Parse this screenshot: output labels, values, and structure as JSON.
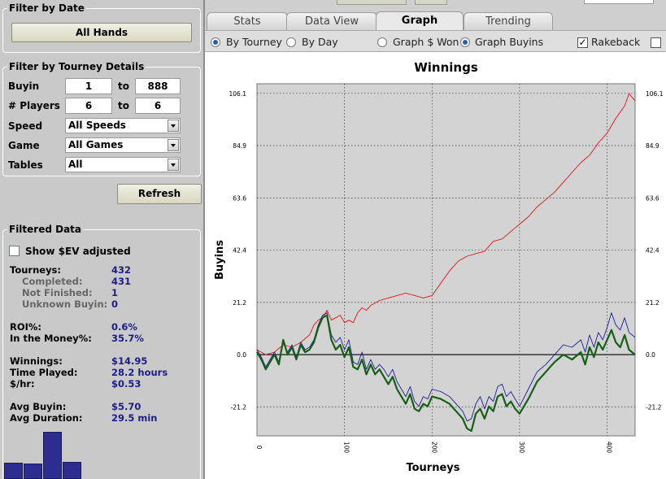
{
  "filter_date": {
    "title": "Filter by Date",
    "button": "All Hands"
  },
  "filter_tourney": {
    "title": "Filter by Tourney Details",
    "buyin": {
      "label": "Buyin",
      "from": "1",
      "to_label": "to",
      "to": "888"
    },
    "players": {
      "label": "# Players",
      "from": "6",
      "to_label": "to",
      "to": "6"
    },
    "speed": {
      "label": "Speed",
      "value": "All Speeds"
    },
    "game": {
      "label": "Game",
      "value": "All Games"
    },
    "tables": {
      "label": "Tables",
      "value": "All"
    },
    "refresh": "Refresh"
  },
  "filtered": {
    "title": "Filtered Data",
    "ev_label": "Show $EV adjusted",
    "stats": [
      {
        "label": "Tourneys:",
        "value": "432",
        "sub": false
      },
      {
        "label": "Completed:",
        "value": "431",
        "sub": true
      },
      {
        "label": "Not Finished:",
        "value": "1",
        "sub": true
      },
      {
        "label": "Unknown Buyin:",
        "value": "0",
        "sub": true
      },
      {
        "label": "ROI%:",
        "value": "0.6%",
        "sub": false
      },
      {
        "label": "In the Money%:",
        "value": "35.7%",
        "sub": false
      },
      {
        "label": "Winnings:",
        "value": "$14.95",
        "sub": false
      },
      {
        "label": "Time Played:",
        "value": "28.2 hours",
        "sub": false
      },
      {
        "label": "$/hr:",
        "value": "$0.53",
        "sub": false
      },
      {
        "label": "Avg Buyin:",
        "value": "$5.70",
        "sub": false
      },
      {
        "label": "Avg Duration:",
        "value": "29.5 min",
        "sub": false
      }
    ],
    "histogram": [
      0.35,
      0.33,
      1.0,
      0.37
    ]
  },
  "tabs": [
    "Stats",
    "Data View",
    "Graph",
    "Trending"
  ],
  "active_tab": "Graph",
  "options": {
    "by_tourney": "By Tourney",
    "by_day": "By Day",
    "graph_won": "Graph $ Won",
    "graph_buyins": "Graph Buyins",
    "rakeback": "Rakeback"
  },
  "colors": {
    "red_series": "#e81616",
    "blue_series": "#1c1c9c",
    "green_series": "#156015",
    "plot_bg": "#d3d3d3",
    "value_text": "#1d1d86"
  },
  "chart_data": {
    "type": "line",
    "title": "Winnings",
    "xlabel": "Tourneys",
    "ylabel": "Buyins",
    "x_ticks": [
      0,
      100,
      200,
      300,
      400
    ],
    "y_ticks": [
      -21.2,
      0.0,
      21.2,
      42.4,
      63.6,
      84.9,
      106.1
    ],
    "xlim": [
      0,
      432
    ],
    "ylim": [
      -33,
      110
    ],
    "grid": true,
    "series": [
      {
        "color": "red",
        "points": [
          [
            0,
            2
          ],
          [
            10,
            0
          ],
          [
            20,
            1
          ],
          [
            30,
            4
          ],
          [
            40,
            3
          ],
          [
            50,
            5
          ],
          [
            60,
            8
          ],
          [
            65,
            12
          ],
          [
            70,
            14
          ],
          [
            75,
            15
          ],
          [
            80,
            18
          ],
          [
            85,
            14
          ],
          [
            90,
            15
          ],
          [
            95,
            16
          ],
          [
            100,
            13
          ],
          [
            105,
            14
          ],
          [
            110,
            13
          ],
          [
            115,
            17
          ],
          [
            120,
            19
          ],
          [
            125,
            18
          ],
          [
            130,
            20
          ],
          [
            140,
            22
          ],
          [
            150,
            23
          ],
          [
            160,
            24
          ],
          [
            170,
            25
          ],
          [
            180,
            24
          ],
          [
            190,
            23
          ],
          [
            200,
            24
          ],
          [
            210,
            29
          ],
          [
            220,
            34
          ],
          [
            230,
            38
          ],
          [
            240,
            40
          ],
          [
            250,
            41
          ],
          [
            260,
            42
          ],
          [
            270,
            46
          ],
          [
            280,
            47
          ],
          [
            290,
            50
          ],
          [
            300,
            53
          ],
          [
            310,
            56
          ],
          [
            320,
            60
          ],
          [
            330,
            63
          ],
          [
            340,
            66
          ],
          [
            350,
            70
          ],
          [
            360,
            74
          ],
          [
            370,
            78
          ],
          [
            380,
            81
          ],
          [
            390,
            86
          ],
          [
            400,
            90
          ],
          [
            410,
            96
          ],
          [
            420,
            101
          ],
          [
            425,
            106
          ],
          [
            432,
            103
          ]
        ]
      },
      {
        "color": "blue",
        "points": [
          [
            0,
            2
          ],
          [
            5,
            -1
          ],
          [
            10,
            -5
          ],
          [
            15,
            -2
          ],
          [
            20,
            1
          ],
          [
            25,
            -3
          ],
          [
            30,
            5
          ],
          [
            35,
            1
          ],
          [
            40,
            4
          ],
          [
            45,
            -1
          ],
          [
            50,
            5
          ],
          [
            55,
            2
          ],
          [
            60,
            3
          ],
          [
            65,
            6
          ],
          [
            70,
            12
          ],
          [
            75,
            16
          ],
          [
            80,
            17
          ],
          [
            85,
            8
          ],
          [
            90,
            5
          ],
          [
            95,
            7
          ],
          [
            100,
            2
          ],
          [
            105,
            6
          ],
          [
            110,
            -3
          ],
          [
            115,
            -4
          ],
          [
            120,
            1
          ],
          [
            125,
            -6
          ],
          [
            130,
            -2
          ],
          [
            135,
            -6
          ],
          [
            140,
            -4
          ],
          [
            145,
            -6
          ],
          [
            150,
            -9
          ],
          [
            155,
            -6
          ],
          [
            160,
            -11
          ],
          [
            165,
            -14
          ],
          [
            170,
            -17
          ],
          [
            175,
            -13
          ],
          [
            180,
            -19
          ],
          [
            185,
            -21
          ],
          [
            190,
            -17
          ],
          [
            195,
            -18
          ],
          [
            200,
            -14
          ],
          [
            210,
            -15
          ],
          [
            220,
            -17
          ],
          [
            230,
            -21
          ],
          [
            235,
            -23
          ],
          [
            240,
            -27
          ],
          [
            245,
            -26
          ],
          [
            250,
            -20
          ],
          [
            255,
            -17
          ],
          [
            260,
            -22
          ],
          [
            265,
            -17
          ],
          [
            270,
            -19
          ],
          [
            275,
            -13
          ],
          [
            280,
            -12
          ],
          [
            285,
            -17
          ],
          [
            290,
            -15
          ],
          [
            295,
            -18
          ],
          [
            300,
            -21
          ],
          [
            310,
            -14
          ],
          [
            320,
            -7
          ],
          [
            330,
            -4
          ],
          [
            340,
            0
          ],
          [
            350,
            4
          ],
          [
            360,
            3
          ],
          [
            370,
            6
          ],
          [
            375,
            1
          ],
          [
            380,
            8
          ],
          [
            385,
            3
          ],
          [
            390,
            9
          ],
          [
            395,
            6
          ],
          [
            400,
            11
          ],
          [
            405,
            17
          ],
          [
            410,
            12
          ],
          [
            415,
            10
          ],
          [
            420,
            15
          ],
          [
            425,
            9
          ],
          [
            432,
            7
          ]
        ]
      },
      {
        "color": "green",
        "points": [
          [
            0,
            1
          ],
          [
            5,
            -2
          ],
          [
            10,
            -6
          ],
          [
            15,
            -3
          ],
          [
            20,
            0
          ],
          [
            25,
            -4
          ],
          [
            30,
            6
          ],
          [
            35,
            0
          ],
          [
            40,
            3
          ],
          [
            45,
            -2
          ],
          [
            50,
            4
          ],
          [
            55,
            1
          ],
          [
            60,
            2
          ],
          [
            65,
            5
          ],
          [
            70,
            11
          ],
          [
            75,
            15
          ],
          [
            80,
            16
          ],
          [
            85,
            6
          ],
          [
            90,
            2
          ],
          [
            95,
            4
          ],
          [
            100,
            -1
          ],
          [
            105,
            3
          ],
          [
            110,
            -5
          ],
          [
            115,
            -6
          ],
          [
            120,
            -2
          ],
          [
            125,
            -8
          ],
          [
            130,
            -4
          ],
          [
            135,
            -8
          ],
          [
            140,
            -6
          ],
          [
            145,
            -9
          ],
          [
            150,
            -12
          ],
          [
            155,
            -9
          ],
          [
            160,
            -14
          ],
          [
            165,
            -17
          ],
          [
            170,
            -20
          ],
          [
            175,
            -16
          ],
          [
            180,
            -22
          ],
          [
            185,
            -23
          ],
          [
            190,
            -20
          ],
          [
            195,
            -21
          ],
          [
            200,
            -17
          ],
          [
            210,
            -18
          ],
          [
            220,
            -20
          ],
          [
            230,
            -24
          ],
          [
            235,
            -26
          ],
          [
            240,
            -30
          ],
          [
            245,
            -31
          ],
          [
            250,
            -24
          ],
          [
            255,
            -22
          ],
          [
            260,
            -26
          ],
          [
            265,
            -21
          ],
          [
            270,
            -23
          ],
          [
            275,
            -17
          ],
          [
            280,
            -16
          ],
          [
            285,
            -21
          ],
          [
            290,
            -19
          ],
          [
            295,
            -22
          ],
          [
            300,
            -24
          ],
          [
            310,
            -18
          ],
          [
            320,
            -11
          ],
          [
            330,
            -7
          ],
          [
            340,
            -3
          ],
          [
            350,
            0
          ],
          [
            360,
            -2
          ],
          [
            370,
            1
          ],
          [
            375,
            -4
          ],
          [
            380,
            3
          ],
          [
            385,
            -1
          ],
          [
            390,
            5
          ],
          [
            395,
            2
          ],
          [
            400,
            6
          ],
          [
            405,
            10
          ],
          [
            410,
            5
          ],
          [
            415,
            3
          ],
          [
            420,
            8
          ],
          [
            425,
            2
          ],
          [
            432,
            0
          ]
        ]
      }
    ]
  }
}
